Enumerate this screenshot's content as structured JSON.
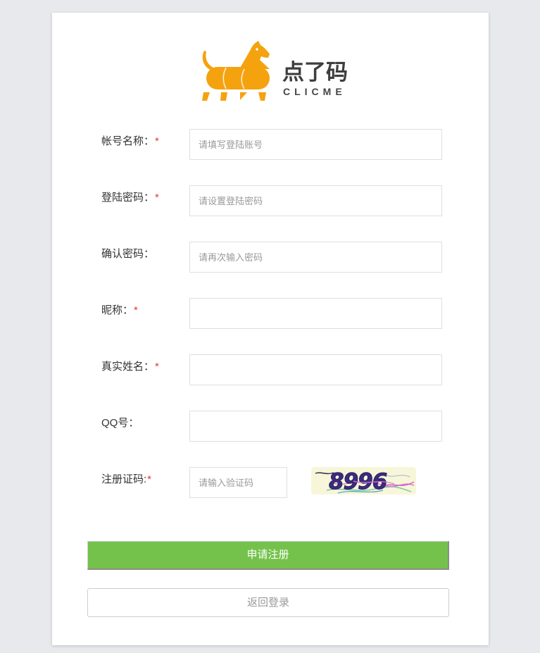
{
  "brand": {
    "name": "点了码",
    "tagline": "CLICME",
    "logo_icon": "horse-logo-icon"
  },
  "form": {
    "required_mark": "*",
    "fields": [
      {
        "label": "帐号名称：",
        "required": true,
        "placeholder": "请填写登陆账号"
      },
      {
        "label": "登陆密码：",
        "required": true,
        "placeholder": "请设置登陆密码"
      },
      {
        "label": "确认密码：",
        "required": false,
        "placeholder": "请再次输入密码"
      },
      {
        "label": "昵称：",
        "required": true,
        "placeholder": ""
      },
      {
        "label": "真实姓名：",
        "required": true,
        "placeholder": ""
      },
      {
        "label": "QQ号：",
        "required": false,
        "placeholder": ""
      }
    ],
    "captcha": {
      "label": "注册证码:",
      "required": true,
      "placeholder": "请输入验证码",
      "code": "8996"
    }
  },
  "actions": {
    "submit_label": "申请注册",
    "back_label": "返回登录"
  },
  "colors": {
    "brand": "#f5a20f",
    "primary_button": "#74c24b",
    "required": "#e4393c",
    "captcha_bg": "#f8f6d8",
    "captcha_text": "#3b2c7e"
  }
}
